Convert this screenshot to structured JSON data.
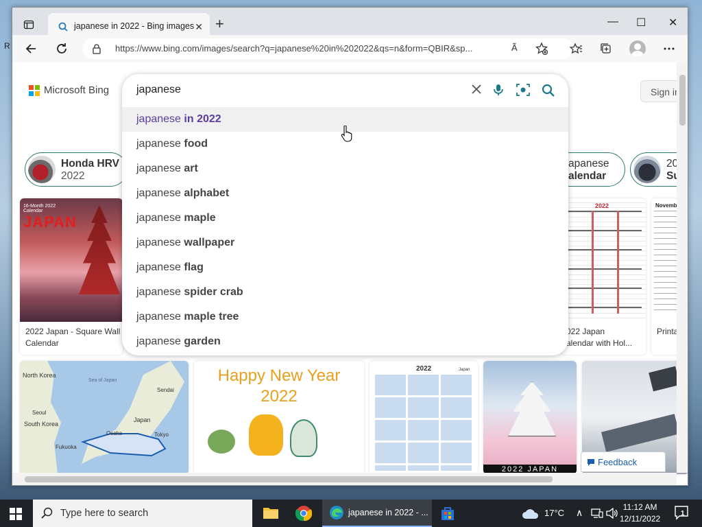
{
  "desktop": {
    "edge_text": "R"
  },
  "tab": {
    "title": "japanese in 2022 - Bing images",
    "close": "✕"
  },
  "new_tab": "+",
  "window_controls": {
    "minimize": "—",
    "maximize": "☐",
    "close": "✕"
  },
  "address": {
    "url": "https://www.bing.com/images/search?q=japanese%20in%202022&qs=n&form=QBIR&sp...",
    "read_aloud": "Ã"
  },
  "page": {
    "logo_text": "Microsoft Bing",
    "sign_in": "Sign in",
    "search_query": "japanese",
    "suggestions": [
      {
        "prefix": "japanese",
        "completion": "in 2022"
      },
      {
        "prefix": "japanese",
        "completion": "food"
      },
      {
        "prefix": "japanese",
        "completion": "art"
      },
      {
        "prefix": "japanese",
        "completion": "alphabet"
      },
      {
        "prefix": "japanese",
        "completion": "maple"
      },
      {
        "prefix": "japanese",
        "completion": "wallpaper"
      },
      {
        "prefix": "japanese",
        "completion": "flag"
      },
      {
        "prefix": "japanese",
        "completion": "spider crab"
      },
      {
        "prefix": "japanese",
        "completion": "maple tree"
      },
      {
        "prefix": "japanese",
        "completion": "garden"
      }
    ],
    "chips": [
      {
        "line1": "Honda HRV",
        "line2": "2022"
      },
      {
        "line1": "apanese",
        "line2": "alendar"
      },
      {
        "line1": "20",
        "line2": "Su"
      }
    ],
    "cards": [
      {
        "caption1": "2022 Japan - Square Wall",
        "caption2": "Calendar",
        "overlay_small": "16-Month 2022 Calendar",
        "overlay_big": "JAPAN"
      },
      {
        "caption1": "022 Japan",
        "caption2": "alendar with Hol...",
        "overlay_big": "2022"
      },
      {
        "caption1": "Printa",
        "caption2": "",
        "overlay_big": "Novemb"
      }
    ],
    "row2": {
      "map_labels": [
        "North Korea",
        "Sea of Japan",
        "South Korea",
        "Seoul",
        "Fukuoka",
        "Osaka",
        "Japan",
        "Sendai",
        "Tokyo"
      ],
      "happy_new_year": "Happy New Year",
      "happy_year": "2022",
      "calendar_year": "2022",
      "calendar_sub": "Japan",
      "japan_banner": "2022 JAPAN"
    },
    "feedback": "Feedback"
  },
  "taskbar": {
    "search_placeholder": "Type here to search",
    "edge_title": "japanese in 2022 - ...",
    "temperature": "17°C",
    "time": "11:12 AM",
    "date": "12/11/2022",
    "notifications": "1"
  },
  "colors": {
    "accent": "#2a7a6d",
    "highlight": "#5b3d9c",
    "taskbar": "#1f2328"
  }
}
